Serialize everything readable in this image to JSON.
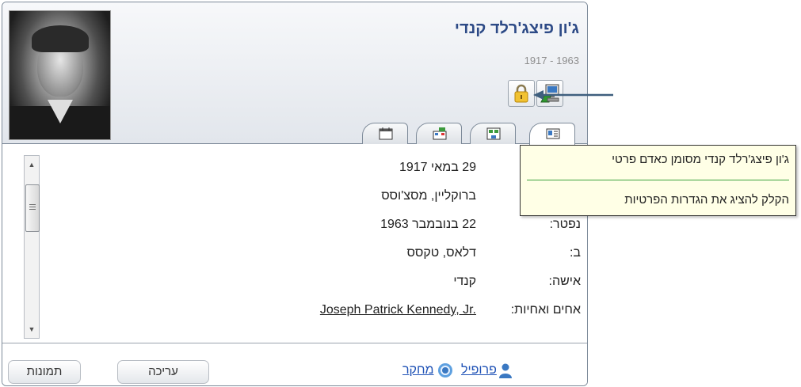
{
  "person": {
    "name": "ג'ון פיצג'רלד קנדי",
    "dates": "1917 - 1963"
  },
  "icons": {
    "privacy_lock": "lock-icon",
    "computer": "computer-icon"
  },
  "tabs": [
    {
      "icon": "contact-card-icon",
      "active": true
    },
    {
      "icon": "family-tree-icon",
      "active": false
    },
    {
      "icon": "family-group-icon",
      "active": false
    },
    {
      "icon": "calendar-icon",
      "active": false
    }
  ],
  "details": [
    {
      "label": "",
      "value": "29 במאי 1917"
    },
    {
      "label": "",
      "value": "ברוקליין, מסצ'וסס"
    },
    {
      "label": "נפטר:",
      "value": "22 בנובמבר 1963"
    },
    {
      "label": "ב:",
      "value": "דלאס, טקסס"
    },
    {
      "label": "אישה:",
      "value": "קנדי"
    },
    {
      "label": "אחים ואחיות:",
      "value": "Joseph Patrick Kennedy, Jr."
    }
  ],
  "footer": {
    "profile_link": "פרופיל",
    "research_link": "מחקר",
    "edit_button": "עריכה",
    "photos_button": "תמונות"
  },
  "tooltip": {
    "title": "ג'ון פיצג'רלד קנדי מסומן כאדם פרטי",
    "hint": "הקלק להציג את הגדרות הפרטיות"
  },
  "colors": {
    "name": "#2d4a86",
    "link": "#1f52b6",
    "tooltip_bg": "#ffffe6",
    "tooltip_separator": "#3fa33f"
  }
}
